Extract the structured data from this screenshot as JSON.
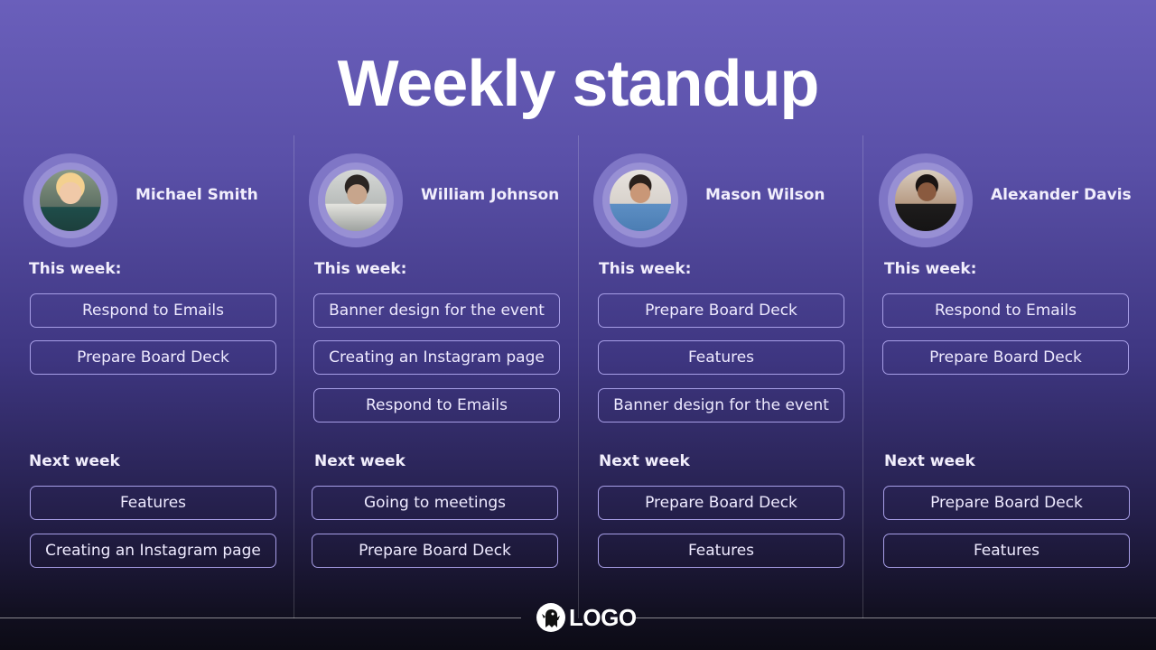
{
  "title": "Weekly standup",
  "labels": {
    "this_week": "This week:",
    "next_week": "Next week"
  },
  "logo": {
    "text": "LOGO",
    "icon": "ghost-icon"
  },
  "members": [
    {
      "name": "Michael Smith",
      "avatar": "person-avatar",
      "this_week": [
        "Respond to Emails",
        "Prepare Board Deck"
      ],
      "next_week": [
        "Features",
        "Creating an Instagram page"
      ]
    },
    {
      "name": "William Johnson",
      "avatar": "person-avatar",
      "this_week": [
        "Banner design for the event",
        "Creating an Instagram page",
        "Respond to Emails"
      ],
      "next_week": [
        "Going to meetings",
        "Prepare Board Deck"
      ]
    },
    {
      "name": "Mason Wilson",
      "avatar": "person-avatar",
      "this_week": [
        "Prepare Board Deck",
        "Features",
        "Banner design for the event"
      ],
      "next_week": [
        "Prepare Board Deck",
        "Features"
      ]
    },
    {
      "name": "Alexander Davis",
      "avatar": "person-avatar",
      "this_week": [
        "Respond to Emails",
        "Prepare Board Deck"
      ],
      "next_week": [
        "Prepare Board Deck",
        "Features"
      ]
    }
  ]
}
